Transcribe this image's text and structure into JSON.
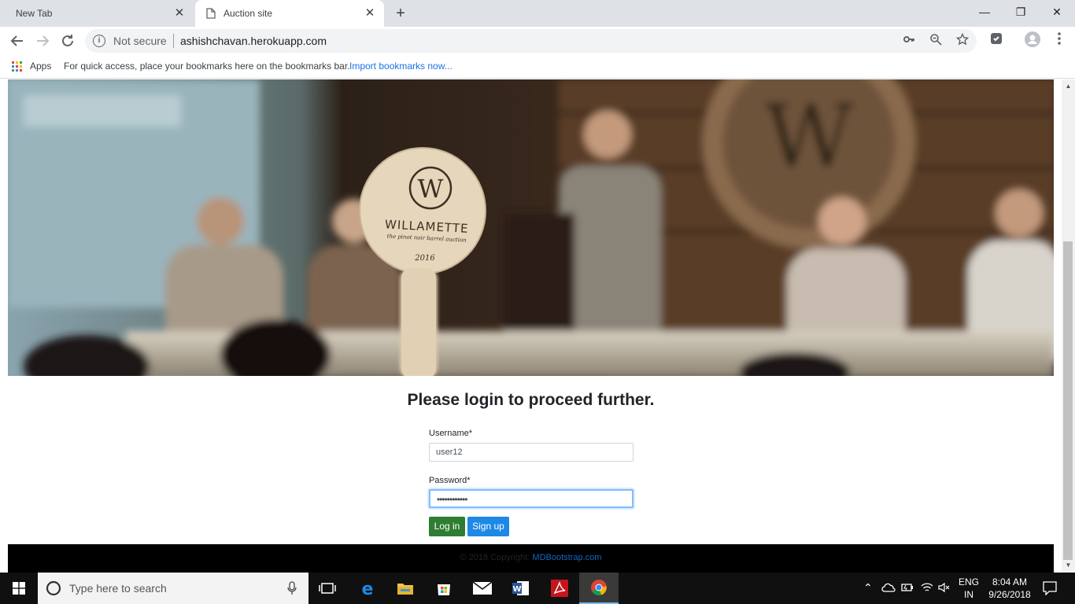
{
  "browser": {
    "tabs": [
      {
        "title": "New Tab",
        "active": false
      },
      {
        "title": "Auction site",
        "active": true
      }
    ],
    "window_controls": {
      "minimize": "—",
      "restore": "❐",
      "close": "✕"
    },
    "security_label": "Not secure",
    "url": "ashishchavan.herokuapp.com",
    "bookmarks": {
      "apps_label": "Apps",
      "hint_text": "For quick access, place your bookmarks here on the bookmarks bar.",
      "import_link": "Import bookmarks now..."
    }
  },
  "hero": {
    "paddle_brand": "WILLAMETTE",
    "paddle_tagline": "the pinot noir barrel auction",
    "paddle_year": "2016",
    "paddle_monogram": "W"
  },
  "login": {
    "title": "Please login to proceed further.",
    "username_label": "Username*",
    "username_value": "user12",
    "password_label": "Password*",
    "password_value": "••••••••••••",
    "login_button": "Log in",
    "signup_button": "Sign up"
  },
  "footer": {
    "copyright": "© 2018 Copyright: ",
    "link": "MDBootstrap.com"
  },
  "taskbar": {
    "search_placeholder": "Type here to search",
    "language_top": "ENG",
    "language_bottom": "IN",
    "time": "8:04 AM",
    "date": "9/26/2018"
  },
  "colors": {
    "login_button": "#2e7d32",
    "signup_button": "#1e88e5",
    "footer_bg": "#000000",
    "taskbar_bg": "#101010"
  }
}
